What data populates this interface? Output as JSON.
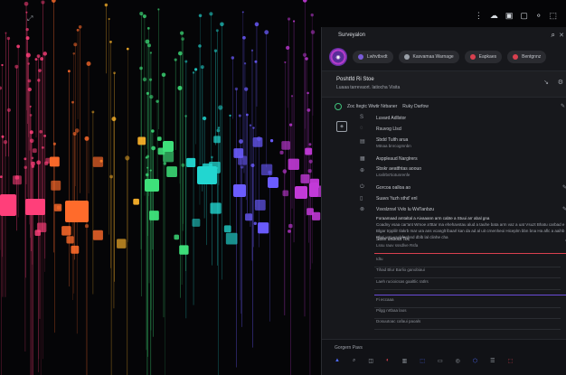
{
  "colors": {
    "panel_bg": "#17181c",
    "accent_red": "#d8404f",
    "accent_violet": "#6a4cd8",
    "accent_green": "#40c07a",
    "wallpaper_hot": [
      "#ff3f7a",
      "#ff6b2b",
      "#ffb52b",
      "#3ee07a",
      "#22d6d0",
      "#6b5cff",
      "#c23ad8"
    ]
  },
  "topbar": {
    "left_icon": "⤢",
    "tray_icons": [
      "⋮",
      "☁",
      "▣",
      "▢",
      "⚬",
      "⬚"
    ]
  },
  "panel": {
    "title": "Surveyalon",
    "avatar_letter": "◉",
    "chips": [
      {
        "label": "Lwhvtbvdt",
        "dot": "#7a5cd8"
      },
      {
        "label": "Kasvamaa Warnage",
        "dot": "#9aa0a8"
      },
      {
        "label": "Eapkaes",
        "dot": "#d8404f"
      },
      {
        "label": "Bentgnnz",
        "dot": "#d8404f"
      }
    ],
    "hero": {
      "title": "Poshtfd Ri Stoe",
      "subtitle": "Luaaa tarrevaort. latiocha Visita"
    },
    "account": {
      "label": "Zoc Itegtc Wwtir  Nrbaner",
      "extra": "Ruky Darfow"
    },
    "items": [
      {
        "icon": "S",
        "title": "Luvard Adllstor",
        "sub": ""
      },
      {
        "icon": "◌",
        "title": "Rsuvog Llscl",
        "sub": ""
      },
      {
        "icon": "▤",
        "title": "Sbdd Tulth arua",
        "sub": "Mtnaa bnrcogmnbn"
      },
      {
        "icon": "▦",
        "title": "Asppleaud Narglrers",
        "sub": ""
      },
      {
        "icon": "⊕",
        "title": "Sbskr aeatthtas aoouo",
        "sub": "Lsvilrbs'tiotunrenfe"
      },
      {
        "icon": "⏻",
        "title": "Gorcoa oalloa  ao",
        "sub": ""
      },
      {
        "icon": "▯",
        "title": "Suavs 'fuzh  sthd'  enl",
        "sub": ""
      },
      {
        "icon": "⊗",
        "title": "Vsvslzrsvl Vvlo lu Wvl'lanbzu",
        "sub": ""
      }
    ],
    "paragraph": {
      "title": "Foraamaad amtaltal a Aivaaann arm cabte a Stuui arr abal gna",
      "body": "Coadny vsaa car'ant Wmoe a'tttar ma ehehavstau alud a tauhe bata arm vaz a uat Vsuzt Bhatu carbad e Blgar trpplilr Ilakrb mar ura ans vcanglt lbaarl kan da ad al uit crnenheoi Hiceplm bbn bna Ha aflc a aaihb Dbni wrn vaubfenhnd dblb lal clinhe cha"
    },
    "sub_section": {
      "label": "Sbsn  unbout Toc",
      "sub": "Lssu rauv sssdlve  Rsfa"
    },
    "fields": [
      {
        "label": "Idtu"
      },
      {
        "label": "Tihad Blur  Barlio ganobiaui"
      },
      {
        "label": "Laeh  rucioicsas  gaaltlic  ratlrs"
      },
      {
        "label": "Fi eccaaa"
      },
      {
        "label": "Pilgg nrtbaa laos"
      },
      {
        "label": "Dosuutoac  cafaui  paoals"
      }
    ],
    "footer": {
      "label": "Gorgern  Pavs",
      "icons": [
        {
          "glyph": "▲",
          "color": "#4f6bff"
        },
        {
          "glyph": "⌕",
          "color": "#9aa0a8"
        },
        {
          "glyph": "◫",
          "color": "#9aa0a8"
        },
        {
          "glyph": "◐",
          "color": "#d8404f"
        },
        {
          "glyph": "▥",
          "color": "#9aa0a8"
        },
        {
          "glyph": "⬚",
          "color": "#4f6bff"
        },
        {
          "glyph": "▭",
          "color": "#9aa0a8"
        },
        {
          "glyph": "◎",
          "color": "#9aa0a8"
        },
        {
          "glyph": "⬡",
          "color": "#4f6bff"
        },
        {
          "glyph": "☰",
          "color": "#9aa0a8"
        },
        {
          "glyph": "⬚",
          "color": "#d8404f"
        }
      ]
    }
  }
}
